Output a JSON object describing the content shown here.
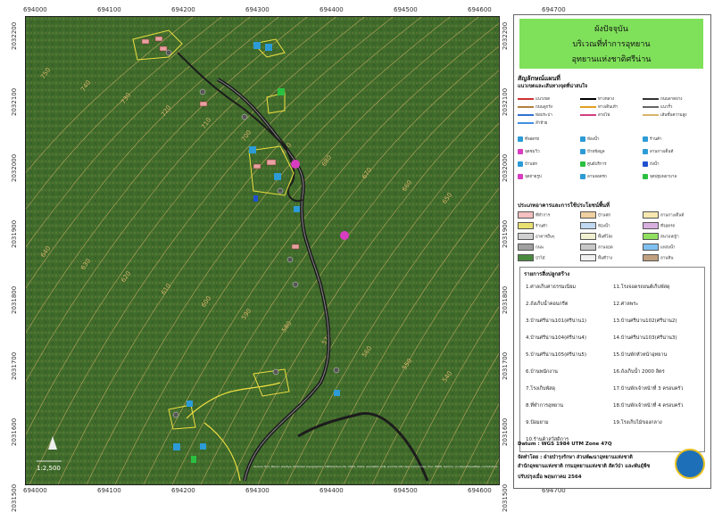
{
  "map": {
    "x_ticks": [
      "694000",
      "694100",
      "694200",
      "694300",
      "694400",
      "694500",
      "694600",
      "694700"
    ],
    "y_ticks": [
      "2032200",
      "2032100",
      "2032000",
      "2031900",
      "2031800",
      "2031700",
      "2031600",
      "2031500"
    ],
    "contour_labels": [
      "750",
      "740",
      "730",
      "720",
      "710",
      "700",
      "690",
      "680",
      "670",
      "660",
      "650",
      "640",
      "630",
      "620",
      "610",
      "600",
      "590",
      "580",
      "570",
      "560",
      "550",
      "540"
    ],
    "scale_label": "1:2,500",
    "attribution": "Source: Esri, Maxar, GeoEye, Earthstar Geographics, CNES/Airbus DS, USDA, USGS, AeroGRID, IGN, and the GIS User Community, Esri, HERE, Garmin, (c) OpenStreetMap contributors",
    "colors": {
      "forest": "#3f6a2a",
      "contour": "#d8b46a",
      "road": "#1c1c1c",
      "trail": "#f0e040"
    }
  },
  "panel": {
    "title": [
      "ผังปัจจุบัน",
      "บริเวณที่ทำการอุทยาน",
      "อุทยานแห่งชาติศรีน่าน"
    ],
    "legend_heading": "สัญลักษณ์แผนที่",
    "legend_sub": "แนวเขตและเส้นทางจุดที่น่าสนใจ",
    "line_symbols": [
      "แนวเขต",
      "ทางหลวง",
      "ถนนลาดยาง",
      "ถนนลูกรัง",
      "ทางเดินเท้า",
      "แนวรั้ว",
      "ท่อประปา",
      "สายไฟ",
      "เส้นชั้นความสูง",
      "ลำห้วย"
    ],
    "point_symbols": [
      "ที่จอดรถ",
      "ห้องน้ำ",
      "ร้านค้า",
      "จุดชมวิว",
      "ป้ายข้อมูล",
      "ลานกางเต็นท์",
      "บ้านพัก",
      "ศูนย์บริการ",
      "ถังน้ำ",
      "จุดถ่ายรูป",
      "ลานจอดรถ",
      "จุดปฐมพยาบาล"
    ],
    "landuse_heading": "ประเภทอาคารและการใช้ประโยชน์พื้นที่",
    "landuse": [
      "ที่ทำการ",
      "บ้านพัก",
      "ลานกางเต็นท์",
      "ร้านค้า",
      "ห้องน้ำ",
      "ที่จอดรถ",
      "อาคารอื่นๆ",
      "พื้นที่โล่ง",
      "สนามหญ้า",
      "ถนน",
      "ลานจอด",
      "แหล่งน้ำ",
      "ป่าไม้",
      "พื้นที่ว่าง",
      "ลานหิน"
    ],
    "buildings_heading": "รายการสิ่งปลูกสร้าง",
    "buildings_left": [
      "1.ศาลเก็บค่าธรรมเนียม",
      "2.ถังเก็บน้ำคอนกรีต",
      "3.บ้านศรีน่าน101(ศรีน่าน1)",
      "4.บ้านศรีน่าน104(ศรีน่าน4)",
      "5.บ้านศรีน่าน105(ศรีน่าน5)",
      "6.บ้านพนักงาน",
      "7.โรงเก็บพัสดุ",
      "8.ที่ทำการอุทยาน",
      "9.ป้อมยาม",
      "10.ร้านค้าสวัสดิการ"
    ],
    "buildings_right": [
      "11.โรงจอดรถยนต์เก็บพัสดุ",
      "12.ศาลพระ",
      "13.บ้านศรีน่าน102(ศรีน่าน2)",
      "14.บ้านศรีน่าน103(ศรีน่าน3)",
      "15.บ้านพักหัวหน้าอุทยาน",
      "16.ถังเก็บน้ำ 2000 ลิตร",
      "17.บ้านพักเจ้าหน้าที่ 3 ครอบครัว",
      "18.บ้านพักเจ้าหน้าที่ 4 ครอบครัว",
      "19.โรงเก็บไม้ของกลาง"
    ],
    "datum": "Datum : WGS 1984 UTM Zone 47Q",
    "made_by": "จัดทำโดย : ฝ่ายบำรุงรักษา ส่วนพัฒนาอุทยานแห่งชาติ",
    "agency": "สำนักอุทยานแห่งชาติ กรมอุทยานแห่งชาติ สัตว์ป่า และพันธุ์พืช",
    "updated": "ปรับปรุงเมื่อ พฤษภาคม 2564"
  }
}
